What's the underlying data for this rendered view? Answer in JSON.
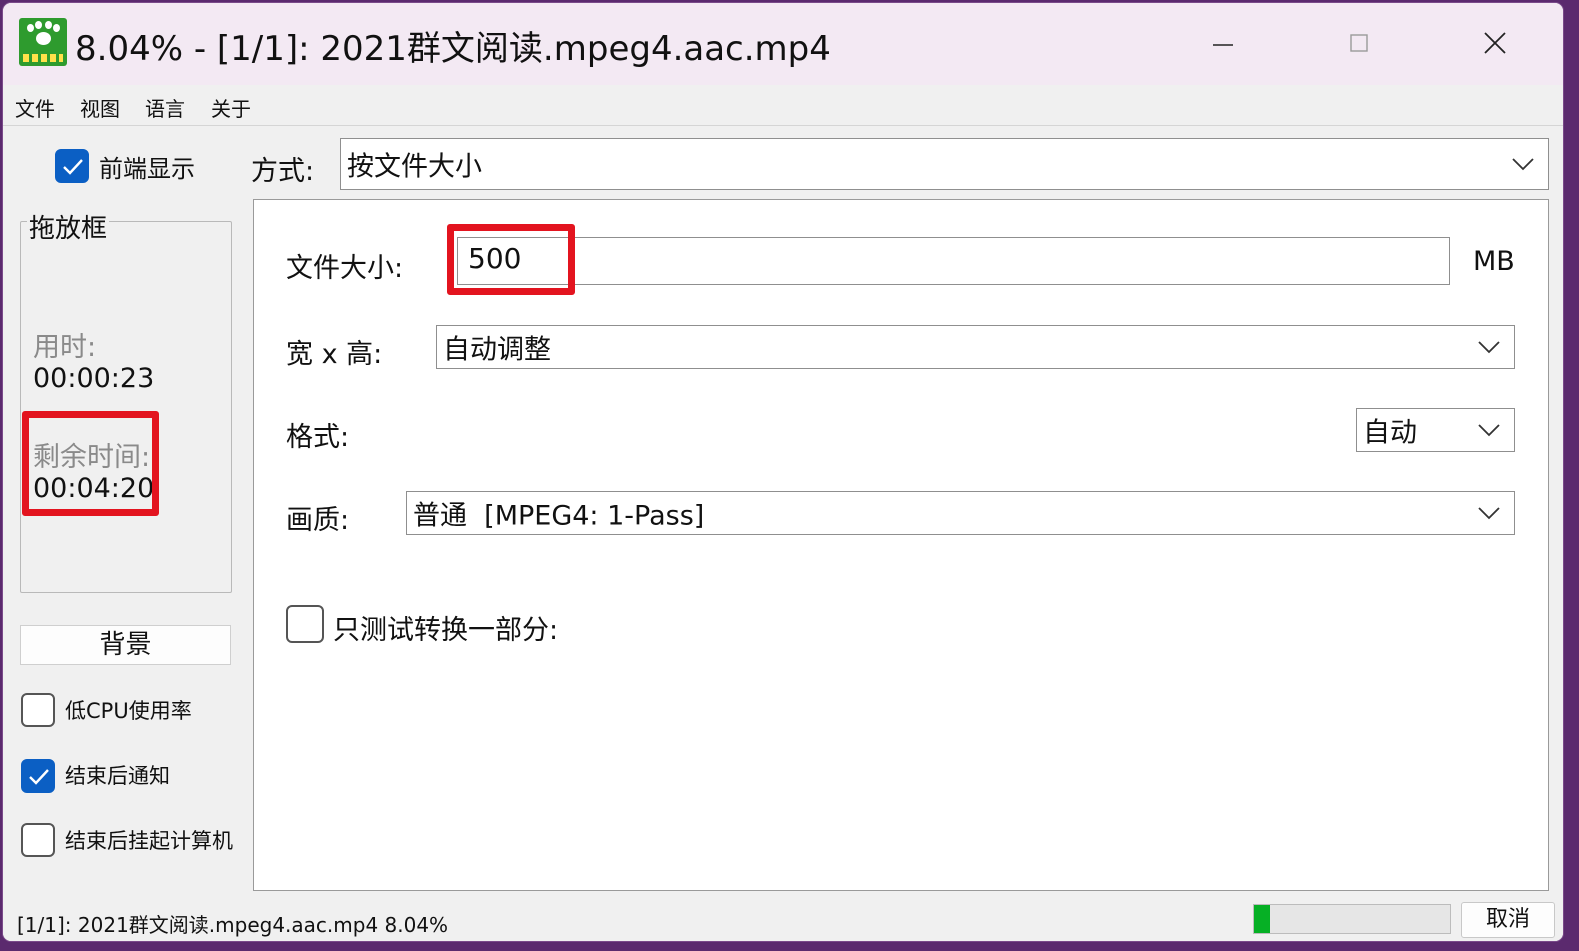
{
  "window": {
    "title": "8.04% - [1/1]: 2021群文阅读.mpeg4.aac.mp4",
    "app_icon": "paw-logo-icon"
  },
  "menu": [
    "文件",
    "视图",
    "语言",
    "关于"
  ],
  "sidebar": {
    "foreground_label": "前端显示",
    "foreground_checked": true,
    "dropzone_title": "拖放框",
    "elapsed_label": "用时:",
    "elapsed_value": "00:00:23",
    "remaining_label": "剩余时间:",
    "remaining_value": "00:04:20",
    "background_button": "背景",
    "low_cpu_label": "低CPU使用率",
    "low_cpu_checked": false,
    "notify_label": "结束后通知",
    "notify_checked": true,
    "suspend_label": "结束后挂起计算机",
    "suspend_checked": false
  },
  "mode": {
    "label": "方式:",
    "value": "按文件大小"
  },
  "form": {
    "filesize_label": "文件大小:",
    "filesize_value": "500",
    "filesize_unit": "MB",
    "dimensions_label": "宽 x 高:",
    "dimensions_value": "自动调整",
    "format_label": "格式:",
    "format_value": "自动",
    "quality_label": "画质:",
    "quality_value": "普通  [MPEG4: 1-Pass]",
    "partial_label": "只测试转换一部分:",
    "partial_checked": false
  },
  "status": {
    "text": "[1/1]: 2021群文阅读.mpeg4.aac.mp4  8.04%",
    "progress_percent": 8.04,
    "cancel_label": "取消"
  },
  "colors": {
    "accent": "#0b5fc4",
    "highlight": "#e3141f",
    "progress": "#06b025"
  }
}
